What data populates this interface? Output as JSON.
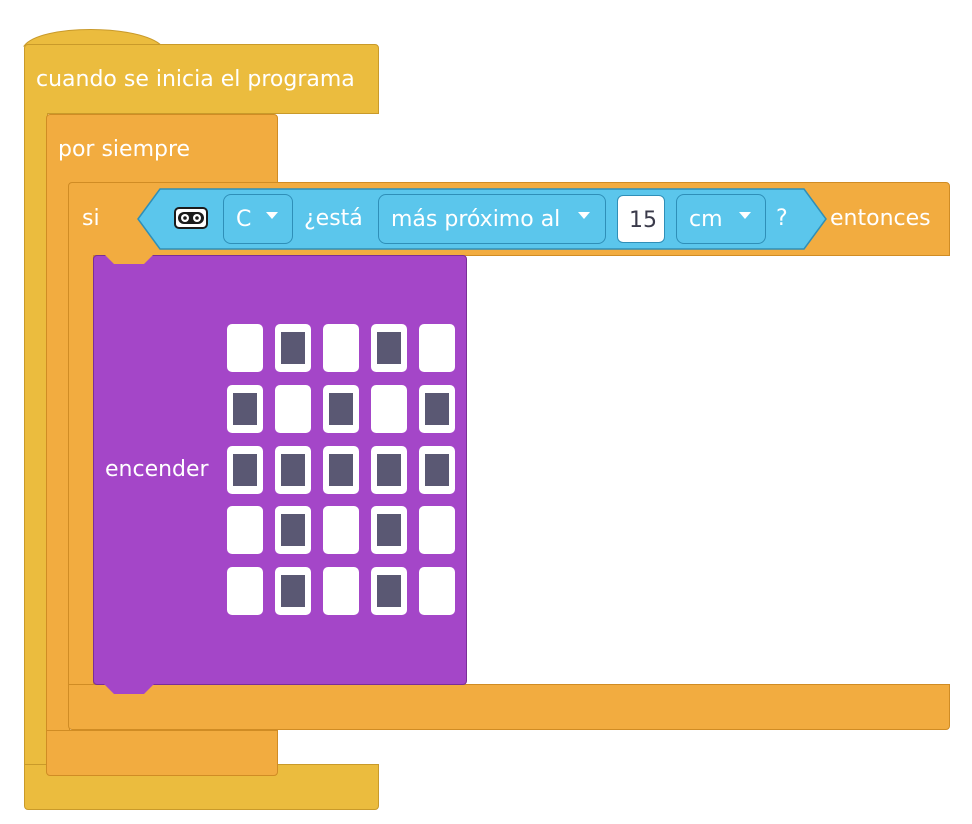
{
  "event_block": {
    "label": "cuando se inicia el programa"
  },
  "forever_block": {
    "label": "por siempre"
  },
  "if_block": {
    "label_if": "si",
    "label_then": "entonces",
    "condition": {
      "sensor_icon": "distance-sensor-icon",
      "port": "C",
      "label_is": "¿está",
      "comparison": "más próximo al",
      "value": "15",
      "unit": "cm",
      "question_mark": "?"
    }
  },
  "light_block": {
    "label": "encender",
    "matrix": [
      [
        0,
        1,
        0,
        1,
        0
      ],
      [
        1,
        0,
        1,
        0,
        1
      ],
      [
        1,
        1,
        1,
        1,
        1
      ],
      [
        0,
        1,
        0,
        1,
        0
      ],
      [
        0,
        1,
        0,
        1,
        0
      ]
    ]
  },
  "colors": {
    "event": "#EBBC3E",
    "control": "#F2AC40",
    "sensor": "#5BC6EC",
    "light": "#A446C8",
    "led_on": "#5a5873"
  }
}
